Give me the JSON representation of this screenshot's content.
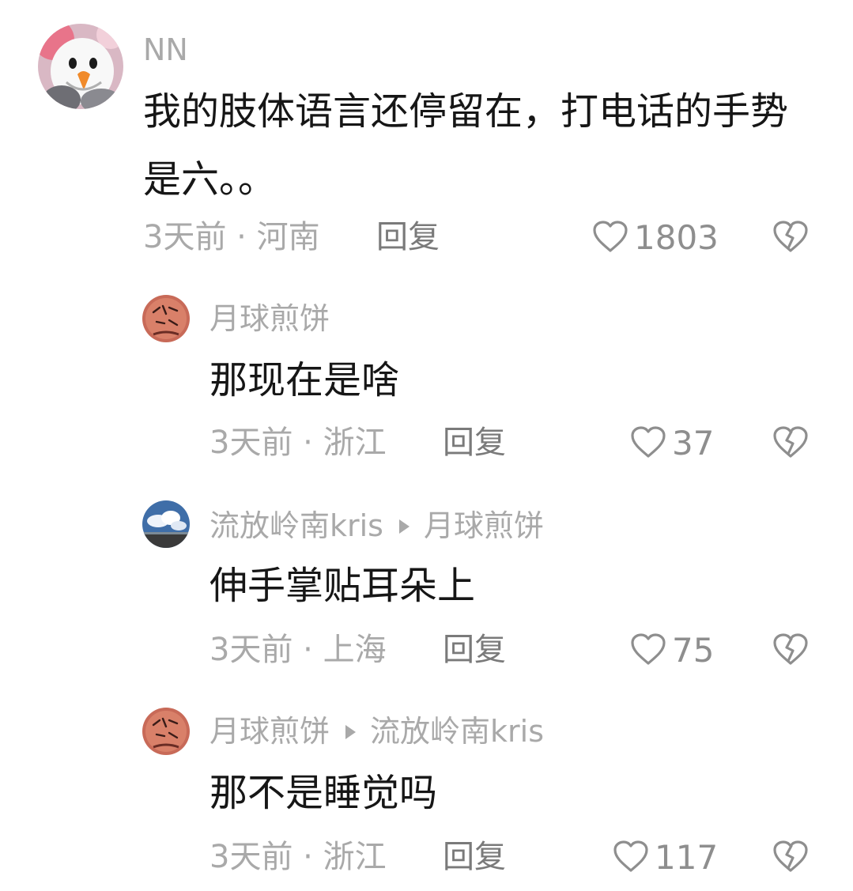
{
  "comments": [
    {
      "username": "NN",
      "reply_to": "",
      "text": "我的肢体语言还停留在，打电话的手势是六。。",
      "meta": "3天前 · 河南",
      "reply_label": "回复",
      "likes": "1803"
    },
    {
      "username": "月球煎饼",
      "reply_to": "",
      "text": "那现在是啥",
      "meta": "3天前 · 浙江",
      "reply_label": "回复",
      "likes": "37"
    },
    {
      "username": "流放岭南kris",
      "reply_to": "月球煎饼",
      "text": "伸手掌贴耳朵上",
      "meta": "3天前 · 上海",
      "reply_label": "回复",
      "likes": "75"
    },
    {
      "username": "月球煎饼",
      "reply_to": "流放岭南kris",
      "text": "那不是睡觉吗",
      "meta": "3天前 · 浙江",
      "reply_label": "回复",
      "likes": "117"
    }
  ],
  "icons": {
    "like": "heart-outline-icon",
    "dislike": "broken-heart-icon"
  },
  "colors": {
    "text": "#161616",
    "muted": "#a9a9a9",
    "reply": "#7a7a7a",
    "icon": "#8e8e8e"
  }
}
